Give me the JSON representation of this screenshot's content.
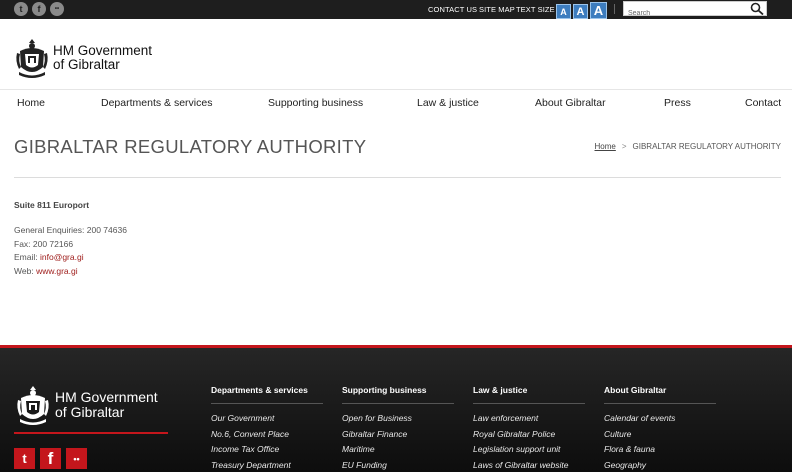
{
  "topbar": {
    "social": [
      {
        "icon": "twitter-icon",
        "glyph": "t"
      },
      {
        "icon": "facebook-icon",
        "glyph": "f"
      },
      {
        "icon": "flickr-icon",
        "glyph": "••"
      }
    ],
    "links": {
      "contact_us": "CONTACT US",
      "site_map": "SITE MAP",
      "text_size": "TEXT SIZE"
    },
    "text_size_buttons": [
      "A",
      "A",
      "A"
    ],
    "search": {
      "placeholder": "Search"
    }
  },
  "header": {
    "logo_line1": "HM Government",
    "logo_line2": "of Gibraltar"
  },
  "nav": {
    "items": [
      "Home",
      "Departments & services",
      "Supporting business",
      "Law & justice",
      "About Gibraltar",
      "Press",
      "Contact"
    ]
  },
  "page": {
    "title": "GIBRALTAR REGULATORY AUTHORITY",
    "breadcrumb": {
      "home": "Home",
      "separator": ">",
      "current": "GIBRALTAR REGULATORY AUTHORITY"
    }
  },
  "content": {
    "address": "Suite 811 Europort",
    "general_label": "General Enquiries: 200 74636",
    "fax_label": "Fax: 200 72166",
    "email_label": "Email:",
    "email_value": "info@gra.gi",
    "web_label": "Web:",
    "web_value": "www.gra.gi"
  },
  "footer": {
    "logo_line1": "HM Government",
    "logo_line2": "of Gibraltar",
    "social": [
      {
        "icon": "twitter-icon",
        "glyph": "t"
      },
      {
        "icon": "facebook-icon",
        "glyph": "f"
      },
      {
        "icon": "flickr-icon",
        "glyph": "••"
      }
    ],
    "columns": [
      {
        "heading": "Departments & services",
        "items": [
          "Our Government",
          "No.6, Convent Place",
          "Income Tax Office",
          "Treasury Department"
        ]
      },
      {
        "heading": "Supporting business",
        "items": [
          "Open for Business",
          "Gibraltar Finance",
          "Maritime",
          "EU Funding"
        ]
      },
      {
        "heading": "Law & justice",
        "items": [
          "Law enforcement",
          "Royal Gibraltar Police",
          "Legislation support unit",
          "Laws of Gibraltar website"
        ]
      },
      {
        "heading": "About Gibraltar",
        "items": [
          "Calendar of events",
          "Culture",
          "Flora & fauna",
          "Geography"
        ]
      }
    ]
  },
  "colors": {
    "topbar": "#1e1e1e",
    "accent_red": "#c4161c",
    "link_red": "#a0201e",
    "textsize_blue": "#3d7dbf"
  }
}
